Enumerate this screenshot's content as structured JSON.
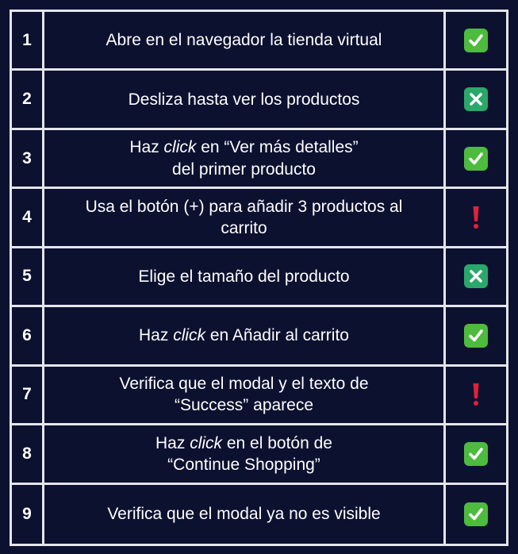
{
  "colors": {
    "background": "#0c1130",
    "grid": "#e4e6ec",
    "check": "#4dbb3e",
    "cross": "#2aa86a",
    "warning": "#e2203a"
  },
  "rows": [
    {
      "num": "1",
      "parts": [
        {
          "t": "Abre en el navegador la tienda virtual"
        }
      ],
      "status": "check-icon"
    },
    {
      "num": "2",
      "parts": [
        {
          "t": "Desliza hasta ver los productos"
        }
      ],
      "status": "cross-icon"
    },
    {
      "num": "3",
      "parts": [
        {
          "t": "Haz "
        },
        {
          "t": "click",
          "i": true
        },
        {
          "t": " en “Ver más detalles”"
        },
        {
          "br": true
        },
        {
          "t": "del primer producto"
        }
      ],
      "status": "check-icon"
    },
    {
      "num": "4",
      "parts": [
        {
          "t": "Usa el botón (+) para añadir 3 productos al"
        },
        {
          "br": true
        },
        {
          "t": "carrito"
        }
      ],
      "status": "exclamation-icon"
    },
    {
      "num": "5",
      "parts": [
        {
          "t": "Elige el tamaño del producto"
        }
      ],
      "status": "cross-icon"
    },
    {
      "num": "6",
      "parts": [
        {
          "t": "Haz "
        },
        {
          "t": "click",
          "i": true
        },
        {
          "t": " en Añadir al carrito"
        }
      ],
      "status": "check-icon"
    },
    {
      "num": "7",
      "parts": [
        {
          "t": "Verifica que el modal y el texto de"
        },
        {
          "br": true
        },
        {
          "t": "“Success” aparece"
        }
      ],
      "status": "exclamation-icon"
    },
    {
      "num": "8",
      "parts": [
        {
          "t": "Haz "
        },
        {
          "t": "click",
          "i": true
        },
        {
          "t": " en el botón de"
        },
        {
          "br": true
        },
        {
          "t": "“Continue Shopping”"
        }
      ],
      "status": "check-icon"
    },
    {
      "num": "9",
      "parts": [
        {
          "t": "Verifica que el modal ya no es visible"
        }
      ],
      "status": "check-icon"
    }
  ]
}
